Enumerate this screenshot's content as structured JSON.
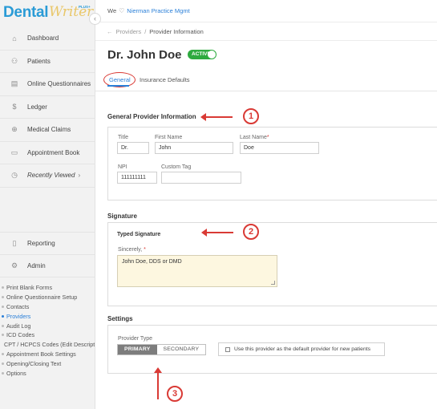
{
  "logo": {
    "brand": "Dental",
    "script": "Writer",
    "plus": "PLUS+"
  },
  "sidebar": {
    "items": [
      {
        "label": "Dashboard",
        "icon": "home-icon"
      },
      {
        "label": "Patients",
        "icon": "patients-icon"
      },
      {
        "label": "Online Questionnaires",
        "icon": "questionnaire-icon"
      },
      {
        "label": "Ledger",
        "icon": "dollar-icon"
      },
      {
        "label": "Medical Claims",
        "icon": "claims-icon"
      },
      {
        "label": "Appointment Book",
        "icon": "calendar-icon"
      },
      {
        "label": "Recently Viewed",
        "icon": "clock-icon"
      }
    ],
    "bottom_items": [
      {
        "label": "Reporting",
        "icon": "report-icon"
      },
      {
        "label": "Admin",
        "icon": "admin-icon"
      }
    ],
    "admin_links": [
      "Print Blank Forms",
      "Online Questionnaire Setup",
      "Contacts",
      "Providers",
      "Audit Log",
      "ICD Codes",
      "CPT / HCPCS Codes (Edit Description)",
      "Appointment Book Settings",
      "Opening/Closing Text",
      "Options"
    ],
    "active_link": "Providers"
  },
  "topbar": {
    "we": "We",
    "practice": "Nierman Practice Mgmt"
  },
  "breadcrumb": {
    "parent": "Providers",
    "current": "Provider Information"
  },
  "header": {
    "name": "Dr. John Doe",
    "status": "ACTIVE"
  },
  "tabs": {
    "general": "General",
    "insurance": "Insurance Defaults"
  },
  "general_info": {
    "title": "General Provider Information",
    "title_label": "Title",
    "title_value": "Dr.",
    "first_label": "First Name",
    "first_value": "John",
    "last_label": "Last Name",
    "last_value": "Doe",
    "npi_label": "NPI",
    "npi_value": "111111111",
    "tag_label": "Custom Tag",
    "tag_value": ""
  },
  "signature": {
    "title": "Signature",
    "subhead": "Typed Signature",
    "sincerely_label": "Sincerely,",
    "value": "John Doe, DDS or DMD"
  },
  "settings": {
    "title": "Settings",
    "provider_type_label": "Provider Type",
    "primary": "PRIMARY",
    "secondary": "SECONDARY",
    "default_checkbox": "Use this provider as the default provider for new patients"
  },
  "annotations": [
    "1",
    "2",
    "3"
  ],
  "colors": {
    "accent": "#2a7fd8",
    "active_green": "#2eaa3f",
    "annotation_red": "#d93a35"
  }
}
